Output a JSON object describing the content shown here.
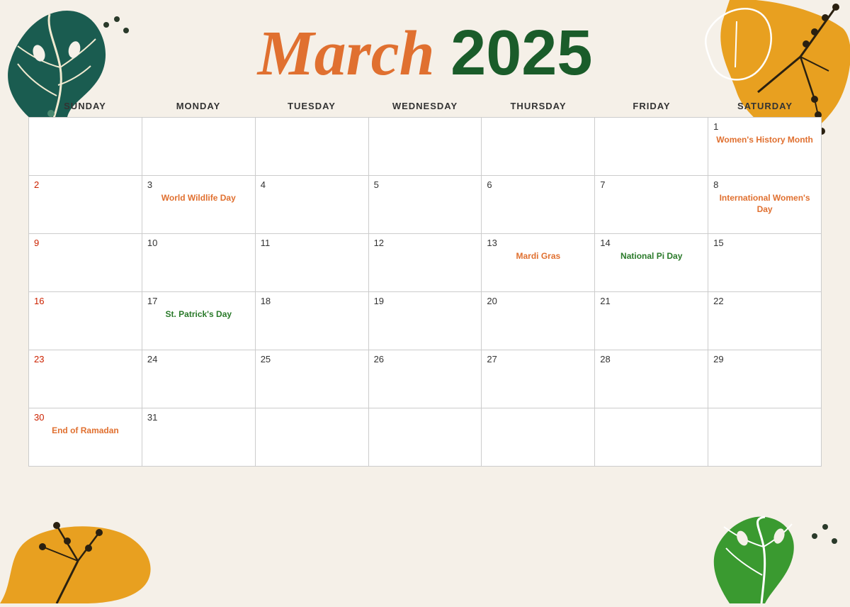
{
  "header": {
    "month": "March",
    "year": "2025"
  },
  "days": [
    "SUNDAY",
    "MONDAY",
    "TUESDAY",
    "WEDNESDAY",
    "THURSDAY",
    "FRIDAY",
    "SATURDAY"
  ],
  "weeks": [
    [
      {
        "date": "",
        "event": "",
        "eventColor": ""
      },
      {
        "date": "",
        "event": "",
        "eventColor": ""
      },
      {
        "date": "",
        "event": "",
        "eventColor": ""
      },
      {
        "date": "",
        "event": "",
        "eventColor": ""
      },
      {
        "date": "",
        "event": "",
        "eventColor": ""
      },
      {
        "date": "",
        "event": "",
        "eventColor": ""
      },
      {
        "date": "1",
        "event": "Women's History Month",
        "eventColor": "orange"
      }
    ],
    [
      {
        "date": "2",
        "event": "",
        "eventColor": "",
        "dateRed": true
      },
      {
        "date": "3",
        "event": "World Wildlife Day",
        "eventColor": "orange"
      },
      {
        "date": "4",
        "event": "",
        "eventColor": ""
      },
      {
        "date": "5",
        "event": "",
        "eventColor": ""
      },
      {
        "date": "6",
        "event": "",
        "eventColor": ""
      },
      {
        "date": "7",
        "event": "",
        "eventColor": ""
      },
      {
        "date": "8",
        "event": "International Women's Day",
        "eventColor": "orange"
      }
    ],
    [
      {
        "date": "9",
        "event": "",
        "eventColor": "",
        "dateRed": true
      },
      {
        "date": "10",
        "event": "",
        "eventColor": ""
      },
      {
        "date": "11",
        "event": "",
        "eventColor": ""
      },
      {
        "date": "12",
        "event": "",
        "eventColor": ""
      },
      {
        "date": "13",
        "event": "Mardi Gras",
        "eventColor": "orange"
      },
      {
        "date": "14",
        "event": "National Pi Day",
        "eventColor": "green"
      },
      {
        "date": "15",
        "event": "",
        "eventColor": ""
      }
    ],
    [
      {
        "date": "16",
        "event": "",
        "eventColor": "",
        "dateRed": true
      },
      {
        "date": "17",
        "event": "St. Patrick's Day",
        "eventColor": "green"
      },
      {
        "date": "18",
        "event": "",
        "eventColor": ""
      },
      {
        "date": "19",
        "event": "",
        "eventColor": ""
      },
      {
        "date": "20",
        "event": "",
        "eventColor": ""
      },
      {
        "date": "21",
        "event": "",
        "eventColor": ""
      },
      {
        "date": "22",
        "event": "",
        "eventColor": ""
      }
    ],
    [
      {
        "date": "23",
        "event": "",
        "eventColor": "",
        "dateRed": true
      },
      {
        "date": "24",
        "event": "",
        "eventColor": ""
      },
      {
        "date": "25",
        "event": "",
        "eventColor": ""
      },
      {
        "date": "26",
        "event": "",
        "eventColor": ""
      },
      {
        "date": "27",
        "event": "",
        "eventColor": ""
      },
      {
        "date": "28",
        "event": "",
        "eventColor": ""
      },
      {
        "date": "29",
        "event": "",
        "eventColor": ""
      }
    ],
    [
      {
        "date": "30",
        "event": "End of Ramadan",
        "eventColor": "orange",
        "dateRed": true
      },
      {
        "date": "31",
        "event": "",
        "eventColor": ""
      },
      {
        "date": "",
        "event": "",
        "eventColor": ""
      },
      {
        "date": "",
        "event": "",
        "eventColor": ""
      },
      {
        "date": "",
        "event": "",
        "eventColor": ""
      },
      {
        "date": "",
        "event": "",
        "eventColor": ""
      },
      {
        "date": "",
        "event": "",
        "eventColor": ""
      }
    ]
  ]
}
